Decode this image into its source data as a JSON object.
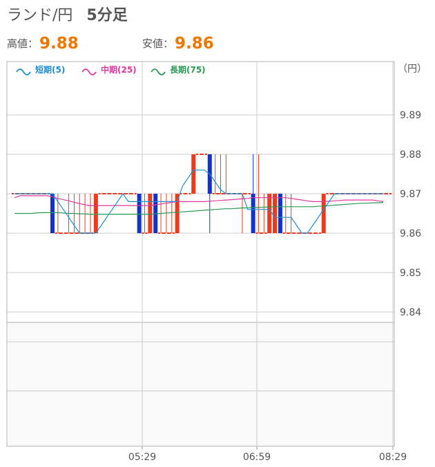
{
  "header": {
    "pair": "ランド/円",
    "timeframe": "5分足"
  },
  "prices": {
    "high_label": "高値：",
    "high_value": "9.88",
    "low_label": "安値：",
    "low_value": "9.86"
  },
  "chart_data": {
    "type": "candlestick",
    "unit_label": "（円）",
    "y_ticks": [
      "9.89",
      "9.88",
      "9.87",
      "9.86",
      "9.85",
      "9.84"
    ],
    "ylim": [
      9.835,
      9.9
    ],
    "x_ticks": [
      "05:29",
      "06:59",
      "08:29"
    ],
    "legend": [
      {
        "name": "短期(5)",
        "color": "#1a8fd8"
      },
      {
        "name": "中期(25)",
        "color": "#e0389e"
      },
      {
        "name": "長期(75)",
        "color": "#2a9a55"
      }
    ],
    "colors": {
      "up": "#ee3a1c",
      "down": "#1133cc",
      "flat": "#ee3a1c",
      "grid": "#cccccc"
    },
    "candles": [
      [
        9.87,
        9.87,
        9.87,
        9.87
      ],
      [
        9.87,
        9.87,
        9.87,
        9.87
      ],
      [
        9.87,
        9.87,
        9.87,
        9.87
      ],
      [
        9.87,
        9.87,
        9.87,
        9.87
      ],
      [
        9.87,
        9.87,
        9.87,
        9.87
      ],
      [
        9.87,
        9.87,
        9.87,
        9.87
      ],
      [
        9.87,
        9.87,
        9.87,
        9.87
      ],
      [
        9.87,
        9.87,
        9.86,
        9.86
      ],
      [
        9.86,
        9.87,
        9.86,
        9.86
      ],
      [
        9.86,
        9.86,
        9.86,
        9.86
      ],
      [
        9.86,
        9.87,
        9.86,
        9.86
      ],
      [
        9.86,
        9.87,
        9.86,
        9.86
      ],
      [
        9.86,
        9.87,
        9.86,
        9.86
      ],
      [
        9.86,
        9.87,
        9.86,
        9.86
      ],
      [
        9.86,
        9.87,
        9.86,
        9.86
      ],
      [
        9.86,
        9.87,
        9.86,
        9.87
      ],
      [
        9.87,
        9.87,
        9.87,
        9.87
      ],
      [
        9.87,
        9.87,
        9.87,
        9.87
      ],
      [
        9.87,
        9.87,
        9.87,
        9.87
      ],
      [
        9.87,
        9.87,
        9.87,
        9.87
      ],
      [
        9.87,
        9.87,
        9.87,
        9.87
      ],
      [
        9.87,
        9.87,
        9.87,
        9.87
      ],
      [
        9.87,
        9.87,
        9.87,
        9.87
      ],
      [
        9.87,
        9.87,
        9.86,
        9.86
      ],
      [
        9.86,
        9.87,
        9.86,
        9.86
      ],
      [
        9.86,
        9.87,
        9.86,
        9.87
      ],
      [
        9.87,
        9.87,
        9.86,
        9.86
      ],
      [
        9.86,
        9.87,
        9.86,
        9.86
      ],
      [
        9.86,
        9.87,
        9.86,
        9.86
      ],
      [
        9.86,
        9.87,
        9.86,
        9.86
      ],
      [
        9.86,
        9.87,
        9.86,
        9.87
      ],
      [
        9.87,
        9.87,
        9.87,
        9.87
      ],
      [
        9.87,
        9.87,
        9.87,
        9.87
      ],
      [
        9.87,
        9.88,
        9.87,
        9.88
      ],
      [
        9.88,
        9.88,
        9.88,
        9.88
      ],
      [
        9.88,
        9.88,
        9.88,
        9.88
      ],
      [
        9.88,
        9.88,
        9.86,
        9.87
      ],
      [
        9.87,
        9.88,
        9.87,
        9.87
      ],
      [
        9.87,
        9.88,
        9.87,
        9.87
      ],
      [
        9.87,
        9.88,
        9.87,
        9.87
      ],
      [
        9.87,
        9.87,
        9.87,
        9.87
      ],
      [
        9.87,
        9.87,
        9.87,
        9.87
      ],
      [
        9.87,
        9.87,
        9.86,
        9.87
      ],
      [
        9.87,
        9.87,
        9.87,
        9.87
      ],
      [
        9.87,
        9.88,
        9.86,
        9.86
      ],
      [
        9.86,
        9.88,
        9.86,
        9.86
      ],
      [
        9.86,
        9.87,
        9.86,
        9.86
      ],
      [
        9.86,
        9.87,
        9.86,
        9.87
      ],
      [
        9.86,
        9.87,
        9.86,
        9.87
      ],
      [
        9.87,
        9.87,
        9.86,
        9.86
      ],
      [
        9.86,
        9.87,
        9.86,
        9.86
      ],
      [
        9.86,
        9.87,
        9.86,
        9.86
      ],
      [
        9.86,
        9.86,
        9.86,
        9.86
      ],
      [
        9.86,
        9.86,
        9.86,
        9.86
      ],
      [
        9.86,
        9.86,
        9.86,
        9.86
      ],
      [
        9.86,
        9.86,
        9.86,
        9.86
      ],
      [
        9.86,
        9.86,
        9.86,
        9.86
      ],
      [
        9.86,
        9.87,
        9.86,
        9.87
      ],
      [
        9.87,
        9.87,
        9.87,
        9.87
      ],
      [
        9.87,
        9.87,
        9.87,
        9.87
      ],
      [
        9.87,
        9.87,
        9.87,
        9.87
      ],
      [
        9.87,
        9.87,
        9.87,
        9.87
      ],
      [
        9.87,
        9.87,
        9.87,
        9.87
      ],
      [
        9.87,
        9.87,
        9.87,
        9.87
      ],
      [
        9.87,
        9.87,
        9.87,
        9.87
      ],
      [
        9.87,
        9.87,
        9.87,
        9.87
      ],
      [
        9.87,
        9.87,
        9.87,
        9.87
      ],
      [
        9.87,
        9.87,
        9.87,
        9.87
      ],
      [
        9.87,
        9.87,
        9.87,
        9.87
      ],
      [
        9.87,
        9.87,
        9.87,
        9.87
      ]
    ],
    "ma_short": [
      9.87,
      9.87,
      9.87,
      9.87,
      9.87,
      9.87,
      9.87,
      9.87,
      9.868,
      9.866,
      9.864,
      9.862,
      9.86,
      9.86,
      9.86,
      9.86,
      9.862,
      9.864,
      9.866,
      9.868,
      9.87,
      9.868,
      9.868,
      9.868,
      9.868,
      9.868,
      9.868,
      9.868,
      9.868,
      9.868,
      9.868,
      9.872,
      9.874,
      9.876,
      9.876,
      9.876,
      9.875,
      9.873,
      9.871,
      9.87,
      9.87,
      9.87,
      9.87,
      9.866,
      9.866,
      9.866,
      9.866,
      9.866,
      9.864,
      9.864,
      9.864,
      9.864,
      9.862,
      9.86,
      9.86,
      9.862,
      9.864,
      9.866,
      9.868,
      9.87,
      9.87,
      9.87,
      9.87,
      9.87,
      9.87,
      9.87,
      9.87,
      9.87,
      9.87
    ],
    "ma_mid": [
      9.869,
      9.8695,
      9.8695,
      9.8695,
      9.8695,
      9.8695,
      9.8695,
      9.8692,
      9.8688,
      9.8685,
      9.8682,
      9.8678,
      9.8675,
      9.8672,
      9.867,
      9.867,
      9.867,
      9.867,
      9.867,
      9.867,
      9.867,
      9.867,
      9.867,
      9.867,
      9.867,
      9.867,
      9.8672,
      9.8674,
      9.8676,
      9.8678,
      9.868,
      9.868,
      9.868,
      9.868,
      9.868,
      9.868,
      9.8681,
      9.8682,
      9.8683,
      9.8684,
      9.8685,
      9.8686,
      9.8687,
      9.8688,
      9.869,
      9.869,
      9.869,
      9.869,
      9.869,
      9.869,
      9.869,
      9.8688,
      9.8686,
      9.8684,
      9.8682,
      9.868,
      9.868,
      9.868,
      9.8681,
      9.8682,
      9.8683,
      9.8684,
      9.8684,
      9.8684,
      9.8684,
      9.8684,
      9.8684,
      9.8682,
      9.868
    ],
    "ma_long": [
      9.865,
      9.865,
      9.865,
      9.865,
      9.8651,
      9.8652,
      9.8652,
      9.8652,
      9.8652,
      9.8651,
      9.865,
      9.865,
      9.8649,
      9.8649,
      9.8648,
      9.8648,
      9.8648,
      9.8648,
      9.8648,
      9.8648,
      9.8648,
      9.8648,
      9.8648,
      9.8648,
      9.8648,
      9.8648,
      9.8649,
      9.865,
      9.8651,
      9.8652,
      9.8653,
      9.8654,
      9.8655,
      9.8656,
      9.8657,
      9.8658,
      9.8659,
      9.866,
      9.8661,
      9.8662,
      9.8662,
      9.8663,
      9.8664,
      9.8664,
      9.8665,
      9.8665,
      9.8666,
      9.8666,
      9.8667,
      9.8667,
      9.8667,
      9.8667,
      9.8667,
      9.8667,
      9.8667,
      9.8667,
      9.8668,
      9.8669,
      9.867,
      9.8671,
      9.8672,
      9.8673,
      9.8674,
      9.8675,
      9.8676,
      9.8676,
      9.8677,
      9.8677,
      9.8678
    ]
  }
}
